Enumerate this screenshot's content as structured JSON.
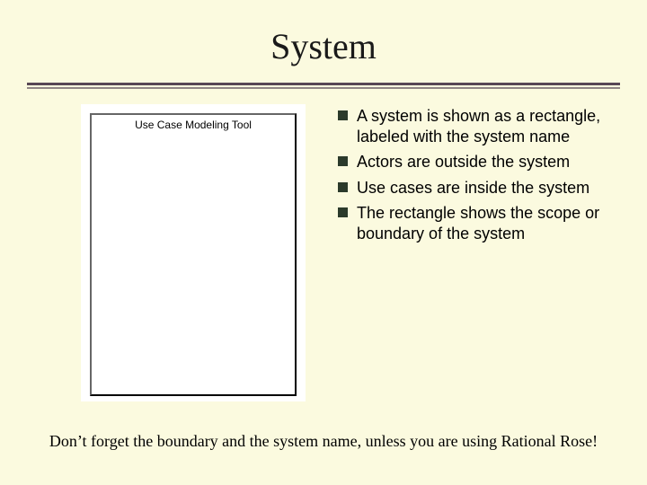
{
  "title": "System",
  "diagram": {
    "label": "Use Case Modeling Tool"
  },
  "bullets": [
    "A system is shown as a rectangle, labeled with the system name",
    "Actors are outside the system",
    "Use cases are inside the system",
    "The rectangle shows the scope or boundary of the system"
  ],
  "footnote": "Don’t forget the boundary and the system name, unless you are using Rational Rose!"
}
